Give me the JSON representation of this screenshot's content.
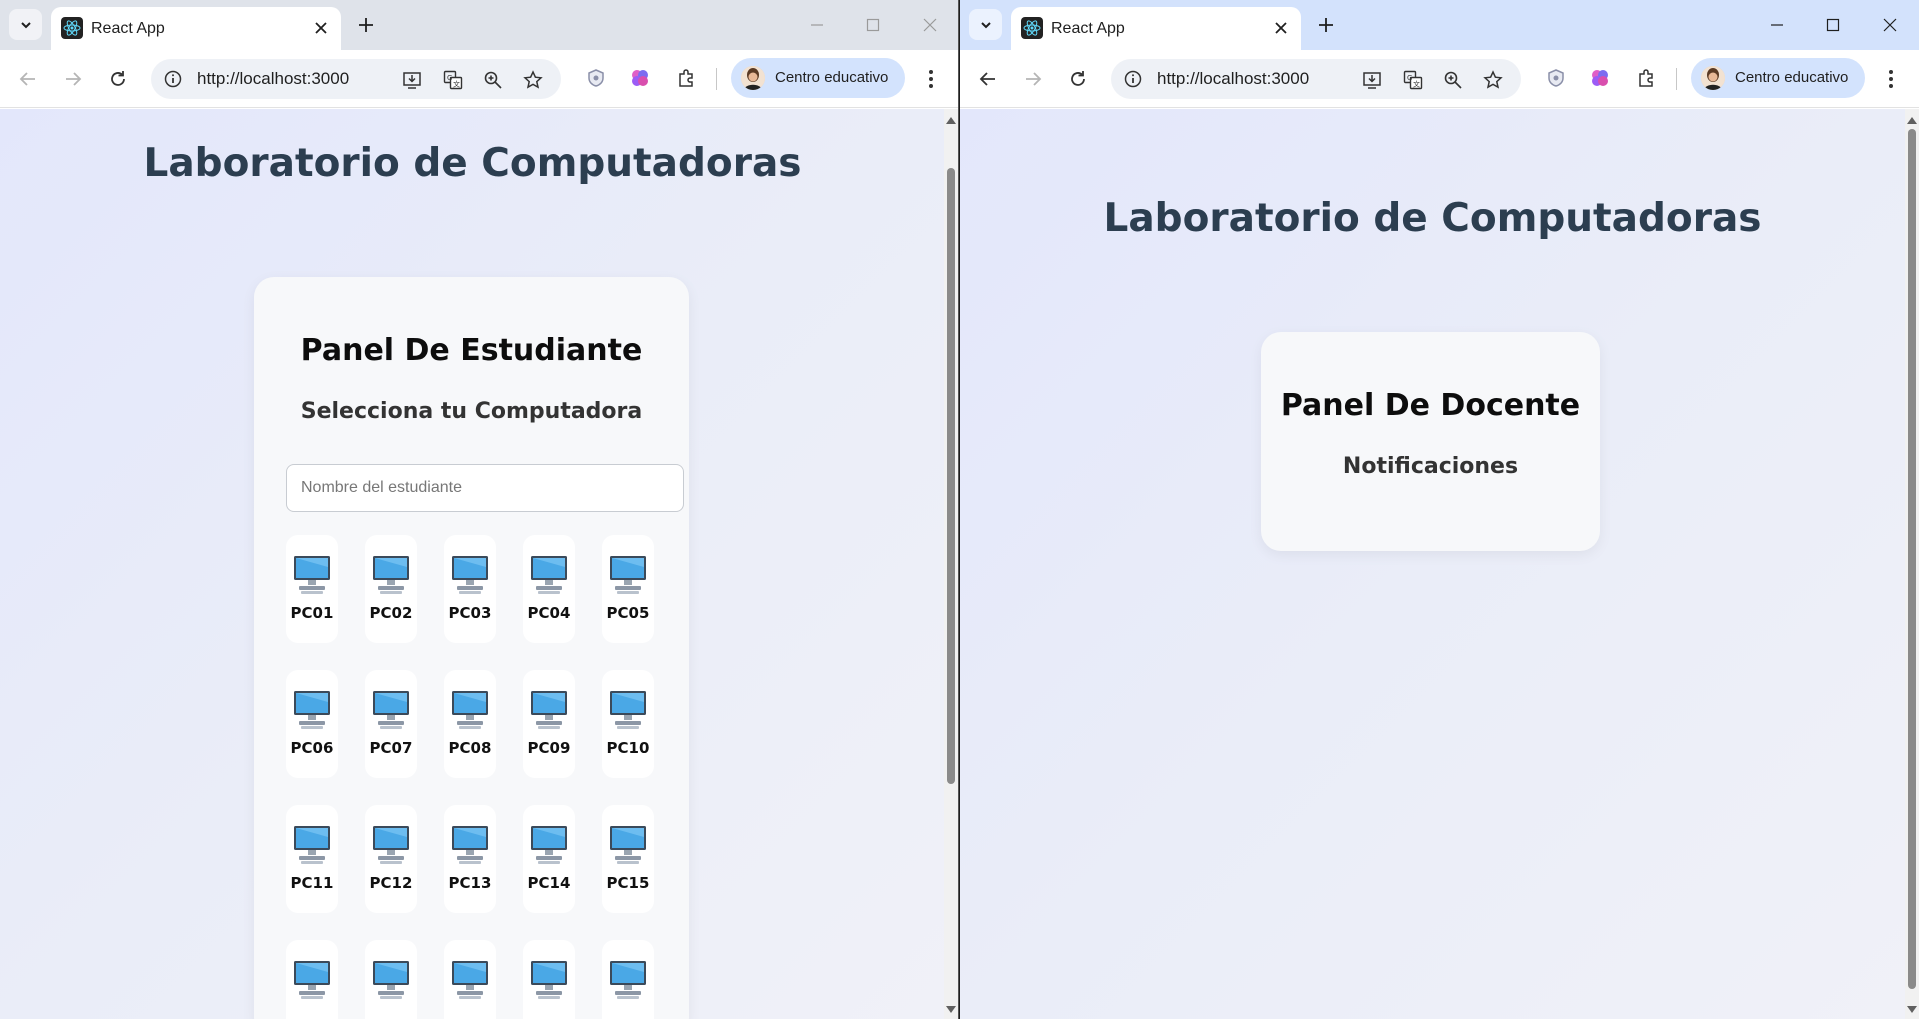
{
  "windows": [
    {
      "tab_title": "React App",
      "url": "http://localhost:3000",
      "profile_name": "Centro educativo",
      "app_title": "Laboratorio de Computadoras",
      "panel": {
        "title": "Panel De Estudiante",
        "subtitle": "Selecciona tu Computadora",
        "name_input_placeholder": "Nombre del estudiante",
        "name_input_value": "",
        "computers": [
          "PC01",
          "PC02",
          "PC03",
          "PC04",
          "PC05",
          "PC06",
          "PC07",
          "PC08",
          "PC09",
          "PC10",
          "PC11",
          "PC12",
          "PC13",
          "PC14",
          "PC15",
          "",
          "",
          "",
          "",
          ""
        ]
      }
    },
    {
      "tab_title": "React App",
      "url": "http://localhost:3000",
      "profile_name": "Centro educativo",
      "app_title": "Laboratorio de Computadoras",
      "panel": {
        "title": "Panel De Docente",
        "subtitle": "Notificaciones"
      }
    }
  ],
  "colors": {
    "title_text": "#2c3e50",
    "left_tabbar": "#dfe3ea",
    "right_tabbar": "#d3e2fc",
    "profile_chip": "#d3e3fd",
    "monitor_screen": "#4aa8e6"
  },
  "icons": [
    "tab-search-icon",
    "react-logo-icon",
    "close-icon",
    "plus-icon",
    "minimize-icon",
    "maximize-icon",
    "back-icon",
    "forward-icon",
    "reload-icon",
    "info-icon",
    "install-app-icon",
    "translate-icon",
    "zoom-icon",
    "bookmark-star-icon",
    "shield-extension-icon",
    "brain-extension-icon",
    "puzzle-extensions-icon",
    "more-vert-icon",
    "computer-icon"
  ]
}
